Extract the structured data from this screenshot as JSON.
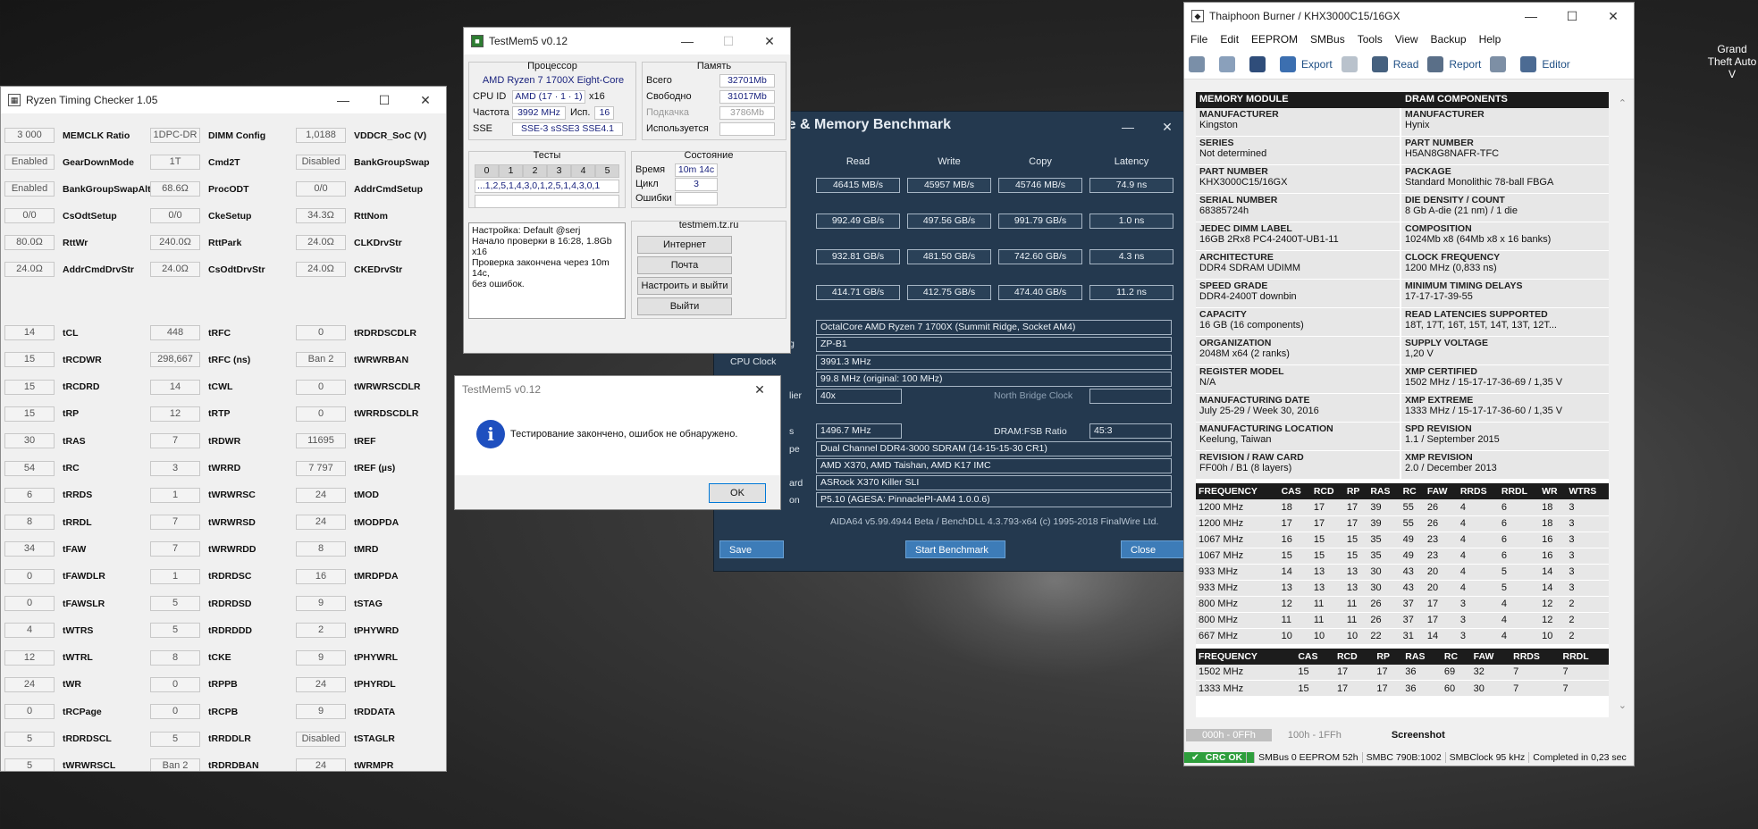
{
  "desktop": {
    "icon_label": "Grand Theft Auto V"
  },
  "rtc": {
    "title": "Ryzen Timing Checker 1.05",
    "rows": [
      [
        [
          "3 000",
          "MEMCLK Ratio"
        ],
        [
          "1DPC-DR",
          "DIMM Config"
        ],
        [
          "1,0188",
          "VDDCR_SoC (V)"
        ]
      ],
      [
        [
          "Enabled",
          "GearDownMode"
        ],
        [
          "1T",
          "Cmd2T"
        ],
        [
          "Disabled",
          "BankGroupSwap"
        ]
      ],
      [
        [
          "Enabled",
          "BankGroupSwapAlt"
        ],
        [
          "68.6Ω",
          "ProcODT"
        ],
        [
          "0/0",
          "AddrCmdSetup"
        ]
      ],
      [
        [
          "0/0",
          "CsOdtSetup"
        ],
        [
          "0/0",
          "CkeSetup"
        ],
        [
          "34.3Ω",
          "RttNom"
        ]
      ],
      [
        [
          "80.0Ω",
          "RttWr"
        ],
        [
          "240.0Ω",
          "RttPark"
        ],
        [
          "24.0Ω",
          "CLKDrvStr"
        ]
      ],
      [
        [
          "24.0Ω",
          "AddrCmdDrvStr"
        ],
        [
          "24.0Ω",
          "CsOdtDrvStr"
        ],
        [
          "24.0Ω",
          "CKEDrvStr"
        ]
      ],
      [
        [
          "14",
          "tCL"
        ],
        [
          "448",
          "tRFC"
        ],
        [
          "0",
          "tRDRDSCDLR"
        ]
      ],
      [
        [
          "15",
          "tRCDWR"
        ],
        [
          "298,667",
          "tRFC (ns)"
        ],
        [
          "Ban 2",
          "tWRWRBAN"
        ]
      ],
      [
        [
          "15",
          "tRCDRD"
        ],
        [
          "14",
          "tCWL"
        ],
        [
          "0",
          "tWRWRSCDLR"
        ]
      ],
      [
        [
          "15",
          "tRP"
        ],
        [
          "12",
          "tRTP"
        ],
        [
          "0",
          "tWRRDSCDLR"
        ]
      ],
      [
        [
          "30",
          "tRAS"
        ],
        [
          "7",
          "tRDWR"
        ],
        [
          "11695",
          "tREF"
        ]
      ],
      [
        [
          "54",
          "tRC"
        ],
        [
          "3",
          "tWRRD"
        ],
        [
          "7 797",
          "tREF (µs)"
        ]
      ],
      [
        [
          "6",
          "tRRDS"
        ],
        [
          "1",
          "tWRWRSC"
        ],
        [
          "24",
          "tMOD"
        ]
      ],
      [
        [
          "8",
          "tRRDL"
        ],
        [
          "7",
          "tWRWRSD"
        ],
        [
          "24",
          "tMODPDA"
        ]
      ],
      [
        [
          "34",
          "tFAW"
        ],
        [
          "7",
          "tWRWRDD"
        ],
        [
          "8",
          "tMRD"
        ]
      ],
      [
        [
          "0",
          "tFAWDLR"
        ],
        [
          "1",
          "tRDRDSC"
        ],
        [
          "16",
          "tMRDPDA"
        ]
      ],
      [
        [
          "0",
          "tFAWSLR"
        ],
        [
          "5",
          "tRDRDSD"
        ],
        [
          "9",
          "tSTAG"
        ]
      ],
      [
        [
          "4",
          "tWTRS"
        ],
        [
          "5",
          "tRDRDDD"
        ],
        [
          "2",
          "tPHYWRD"
        ]
      ],
      [
        [
          "12",
          "tWTRL"
        ],
        [
          "8",
          "tCKE"
        ],
        [
          "9",
          "tPHYWRL"
        ]
      ],
      [
        [
          "24",
          "tWR"
        ],
        [
          "0",
          "tRPPB"
        ],
        [
          "24",
          "tPHYRDL"
        ]
      ],
      [
        [
          "0",
          "tRCPage"
        ],
        [
          "0",
          "tRCPB"
        ],
        [
          "9",
          "tRDDATA"
        ]
      ],
      [
        [
          "5",
          "tRDRDSCL"
        ],
        [
          "5",
          "tRRDDLR"
        ],
        [
          "Disabled",
          "tSTAGLR"
        ]
      ],
      [
        [
          "5",
          "tWRWRSCL"
        ],
        [
          "Ban 2",
          "tRDRDBAN"
        ],
        [
          "24",
          "tWRMPR"
        ]
      ]
    ]
  },
  "tm5": {
    "title": "TestMem5 v0.12",
    "cpu_legend": "Процессор",
    "cpu_name": "AMD Ryzen 7 1700X Eight-Core",
    "cpuid_label": "CPU ID",
    "cpuid_value": "AMD  (17 · 1 · 1)",
    "cpuid_threads": "x16",
    "freq_label": "Частота",
    "freq_value": "3992 MHz",
    "used_label": "Исп.",
    "used_value": "16",
    "sse_label": "SSE",
    "sse_value": "SSE-3 sSSE3 SSE4.1",
    "mem_legend": "Память",
    "mem_rows": [
      [
        "Всего",
        "32701Mb"
      ],
      [
        "Свободно",
        "31017Mb"
      ],
      [
        "Подкачка",
        "3786Mb"
      ],
      [
        "Используется",
        ""
      ]
    ],
    "tests_legend": "Тесты",
    "test_nums": [
      "0",
      "1",
      "2",
      "3",
      "4",
      "5"
    ],
    "test_seq": "...1,2,5,1,4,3,0,1,2,5,1,4,3,0,1",
    "state_legend": "Состояние",
    "state_rows": [
      [
        "Время",
        "10m 14c"
      ],
      [
        "Цикл",
        "3"
      ],
      [
        "Ошибки",
        ""
      ]
    ],
    "log": [
      "Настройка: Default @serj",
      "Начало проверки в 16:28, 1.8Gb x16",
      "Проверка закончена через 10m 14c,",
      "без ошибок."
    ],
    "site": "testmem.tz.ru",
    "buttons": [
      "Интернет",
      "Почта",
      "Настроить и выйти",
      "Выйти"
    ]
  },
  "dialog": {
    "title": "TestMem5 v0.12",
    "message": "Тестирование закончено, ошибок не обнаружено.",
    "ok": "OK"
  },
  "aida": {
    "title": "che & Memory Benchmark",
    "cols": [
      "Read",
      "Write",
      "Copy",
      "Latency"
    ],
    "rows": [
      [
        "46415 MB/s",
        "45957 MB/s",
        "45746 MB/s",
        "74.9 ns"
      ],
      [
        "992.49 GB/s",
        "497.56 GB/s",
        "991.79 GB/s",
        "1.0 ns"
      ],
      [
        "932.81 GB/s",
        "481.50 GB/s",
        "742.60 GB/s",
        "4.3 ns"
      ],
      [
        "414.71 GB/s",
        "412.75 GB/s",
        "474.40 GB/s",
        "11.2 ns"
      ]
    ],
    "cpu_type": "OctalCore AMD Ryzen 7 1700X  (Summit Ridge, Socket AM4)",
    "stepping_lbl": "g",
    "stepping": "ZP-B1",
    "cpu_clock_lbl": "CPU Clock",
    "cpu_clock": "3991.3 MHz",
    "fsb": "99.8 MHz  (original: 100 MHz)",
    "mult_lbl": "lier",
    "mult": "40x",
    "nb_lbl": "North Bridge Clock",
    "mem_lbl": "s",
    "mem_clock": "1496.7 MHz",
    "dram_lbl": "DRAM:FSB Ratio",
    "dram_ratio": "45:3",
    "type_lbl": "pe",
    "mem_type": "Dual Channel DDR4-3000 SDRAM  (14-15-15-30 CR1)",
    "chipset": "AMD X370, AMD Taishan, AMD K17 IMC",
    "mb_lbl": "ard",
    "motherboard": "ASRock X370 Killer SLI",
    "bios_lbl": "on",
    "bios": "P5.10  (AGESA: PinnaclePI-AM4 1.0.0.6)",
    "footer": "AIDA64 v5.99.4944 Beta / BenchDLL 4.3.793-x64  (c) 1995-2018 FinalWire Ltd.",
    "save": "Save",
    "start": "Start Benchmark",
    "close": "Close"
  },
  "tb": {
    "title": "Thaiphoon Burner / KHX3000C15/16GX",
    "menu": [
      "File",
      "Edit",
      "EEPROM",
      "SMBus",
      "Tools",
      "View",
      "Backup",
      "Help"
    ],
    "toolbar": {
      "export": "Export",
      "read": "Read",
      "report": "Report",
      "editor": "Editor"
    },
    "hdr_left": "MEMORY MODULE",
    "hdr_right": "DRAM COMPONENTS",
    "left": [
      [
        "MANUFACTURER",
        "Kingston"
      ],
      [
        "SERIES",
        "Not determined"
      ],
      [
        "PART NUMBER",
        "KHX3000C15/16GX"
      ],
      [
        "SERIAL NUMBER",
        "68385724h"
      ],
      [
        "JEDEC DIMM LABEL",
        "16GB 2Rx8 PC4-2400T-UB1-11"
      ],
      [
        "ARCHITECTURE",
        "DDR4 SDRAM UDIMM"
      ],
      [
        "SPEED GRADE",
        "DDR4-2400T downbin"
      ],
      [
        "CAPACITY",
        "16 GB (16 components)"
      ],
      [
        "ORGANIZATION",
        "2048M x64 (2 ranks)"
      ],
      [
        "REGISTER MODEL",
        "N/A"
      ],
      [
        "MANUFACTURING DATE",
        "July 25-29 / Week 30, 2016"
      ],
      [
        "MANUFACTURING LOCATION",
        "Keelung, Taiwan"
      ],
      [
        "REVISION / RAW CARD",
        "FF00h / B1 (8 layers)"
      ]
    ],
    "right": [
      [
        "MANUFACTURER",
        "Hynix"
      ],
      [
        "PART NUMBER",
        "H5AN8G8NAFR-TFC"
      ],
      [
        "PACKAGE",
        "Standard Monolithic 78-ball FBGA"
      ],
      [
        "DIE DENSITY / COUNT",
        "8 Gb A-die (21 nm) / 1 die"
      ],
      [
        "COMPOSITION",
        "1024Mb x8 (64Mb x8 x 16 banks)"
      ],
      [
        "CLOCK FREQUENCY",
        "1200 MHz (0,833 ns)"
      ],
      [
        "MINIMUM TIMING DELAYS",
        "17-17-17-39-55"
      ],
      [
        "READ LATENCIES SUPPORTED",
        "18T, 17T, 16T, 15T, 14T, 13T, 12T..."
      ],
      [
        "SUPPLY VOLTAGE",
        "1,20 V"
      ],
      [
        "XMP CERTIFIED",
        "1502 MHz / 15-17-17-36-69 / 1,35 V"
      ],
      [
        "XMP EXTREME",
        "1333 MHz / 15-17-17-36-60 / 1,35 V"
      ],
      [
        "SPD REVISION",
        "1.1 / September 2015"
      ],
      [
        "XMP REVISION",
        "2.0 / December 2013"
      ]
    ],
    "freq_hdr": [
      "FREQUENCY",
      "CAS",
      "RCD",
      "RP",
      "RAS",
      "RC",
      "FAW",
      "RRDS",
      "RRDL",
      "WR",
      "WTRS"
    ],
    "freq_rows": [
      [
        "1200 MHz",
        "18",
        "17",
        "17",
        "39",
        "55",
        "26",
        "4",
        "6",
        "18",
        "3"
      ],
      [
        "1200 MHz",
        "17",
        "17",
        "17",
        "39",
        "55",
        "26",
        "4",
        "6",
        "18",
        "3"
      ],
      [
        "1067 MHz",
        "16",
        "15",
        "15",
        "35",
        "49",
        "23",
        "4",
        "6",
        "16",
        "3"
      ],
      [
        "1067 MHz",
        "15",
        "15",
        "15",
        "35",
        "49",
        "23",
        "4",
        "6",
        "16",
        "3"
      ],
      [
        "933 MHz",
        "14",
        "13",
        "13",
        "30",
        "43",
        "20",
        "4",
        "5",
        "14",
        "3"
      ],
      [
        "933 MHz",
        "13",
        "13",
        "13",
        "30",
        "43",
        "20",
        "4",
        "5",
        "14",
        "3"
      ],
      [
        "800 MHz",
        "12",
        "11",
        "11",
        "26",
        "37",
        "17",
        "3",
        "4",
        "12",
        "2"
      ],
      [
        "800 MHz",
        "11",
        "11",
        "11",
        "26",
        "37",
        "17",
        "3",
        "4",
        "12",
        "2"
      ],
      [
        "667 MHz",
        "10",
        "10",
        "10",
        "22",
        "31",
        "14",
        "3",
        "4",
        "10",
        "2"
      ]
    ],
    "xmp_hdr": [
      "FREQUENCY",
      "CAS",
      "RCD",
      "RP",
      "RAS",
      "RC",
      "FAW",
      "RRDS",
      "RRDL"
    ],
    "xmp_rows": [
      [
        "1502 MHz",
        "15",
        "17",
        "17",
        "36",
        "69",
        "32",
        "7",
        "7"
      ],
      [
        "1333 MHz",
        "15",
        "17",
        "17",
        "36",
        "60",
        "30",
        "7",
        "7"
      ]
    ],
    "tabs": [
      "000h - 0FFh",
      "100h - 1FFh",
      "Screenshot"
    ],
    "status": [
      "CRC OK",
      "SMBus 0 EEPROM 52h",
      "SMBC 790B:1002",
      "SMBClock 95 kHz",
      "Completed in 0,23 sec"
    ]
  }
}
